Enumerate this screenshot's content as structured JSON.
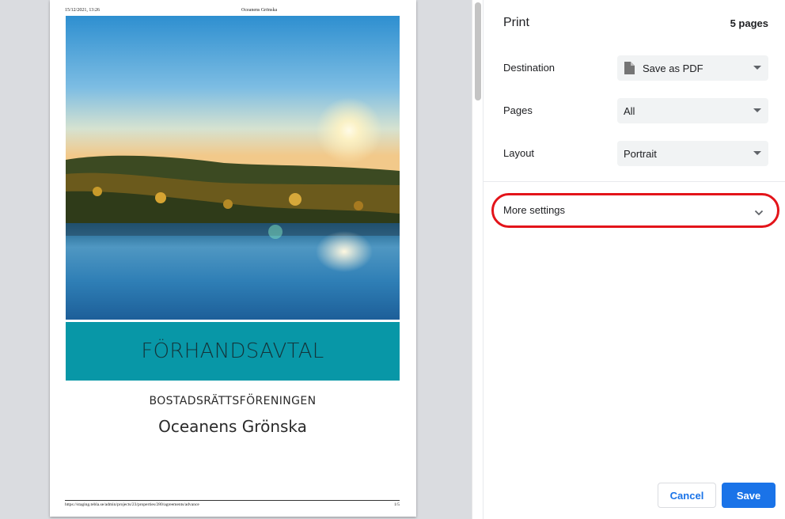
{
  "preview": {
    "header_datetime": "15/12/2021, 13:26",
    "header_title": "Oceanens Grönska",
    "banner_title": "FÖRHANDSAVTAL",
    "association_label": "BOSTADSRÄTTSFÖRENINGEN",
    "association_name": "Oceanens Grönska",
    "footer_url": "https://staging.tebla.se/admin/projects/23/properties/280/agreements/advance",
    "footer_page": "1/5"
  },
  "panel": {
    "title": "Print",
    "page_count": "5 pages",
    "destination": {
      "label": "Destination",
      "value": "Save as PDF",
      "icon": "document-icon"
    },
    "pages": {
      "label": "Pages",
      "value": "All"
    },
    "layout": {
      "label": "Layout",
      "value": "Portrait"
    },
    "more_settings": {
      "label": "More settings",
      "icon": "chevron-down-icon"
    },
    "cancel_label": "Cancel",
    "save_label": "Save"
  },
  "colors": {
    "accent": "#1a73e8",
    "banner": "#0897a7",
    "highlight": "#e3141a"
  }
}
